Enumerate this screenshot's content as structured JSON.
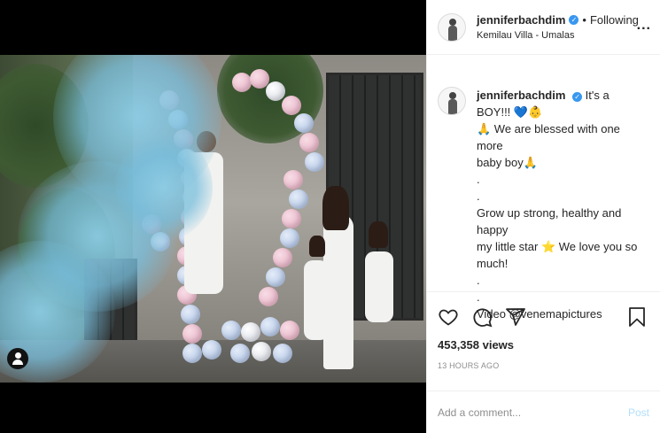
{
  "post": {
    "username": "jenniferbachdim",
    "follow_status": "Following",
    "location": "Kemilau Villa - Umalas",
    "more_label": "...",
    "caption_lines": [
      "It's a BOY!!! 💙👶",
      "🙏 We are blessed with one more",
      "baby boy🙏",
      ".",
      ".",
      "Grow up strong, healthy and happy",
      "my little star ⭐ We love you so",
      "much!",
      ".",
      ".",
      "Video @venemapictures"
    ],
    "views": "453,358 views",
    "time": "13 HOURS AGO"
  },
  "comment": {
    "placeholder": "Add a comment...",
    "post_label": "Post"
  },
  "icons": [
    "heart-icon",
    "comment-icon",
    "share-icon",
    "bookmark-icon",
    "user-tag-icon",
    "verified-icon",
    "more-options-icon"
  ],
  "colors": {
    "verified": "#3897f0",
    "post_button": "#b2dffc",
    "muted": "#8e8e8e"
  }
}
